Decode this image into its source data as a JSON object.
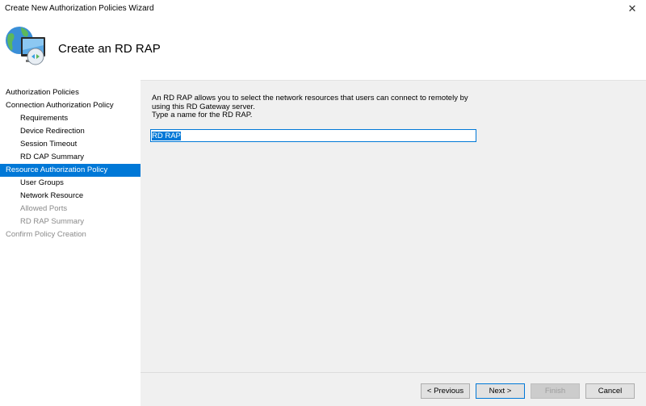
{
  "window": {
    "title": "Create New Authorization Policies Wizard",
    "close_glyph": "✕"
  },
  "header": {
    "icon": "globe-computer-gateway-icon",
    "title": "Create an RD RAP"
  },
  "nav": {
    "items": [
      {
        "label": "Authorization Policies",
        "level": 1,
        "state": "enabled"
      },
      {
        "label": "Connection Authorization Policy",
        "level": 1,
        "state": "enabled"
      },
      {
        "label": "Requirements",
        "level": 2,
        "state": "enabled"
      },
      {
        "label": "Device Redirection",
        "level": 2,
        "state": "enabled"
      },
      {
        "label": "Session Timeout",
        "level": 2,
        "state": "enabled"
      },
      {
        "label": "RD CAP Summary",
        "level": 2,
        "state": "enabled"
      },
      {
        "label": "Resource Authorization Policy",
        "level": 1,
        "state": "active"
      },
      {
        "label": "User Groups",
        "level": 2,
        "state": "enabled"
      },
      {
        "label": "Network Resource",
        "level": 2,
        "state": "enabled"
      },
      {
        "label": "Allowed Ports",
        "level": 2,
        "state": "disabled"
      },
      {
        "label": "RD RAP Summary",
        "level": 2,
        "state": "disabled"
      },
      {
        "label": "Confirm Policy Creation",
        "level": 1,
        "state": "disabled"
      }
    ]
  },
  "content": {
    "description_line1": "An RD RAP allows you to select the network resources that users can connect to remotely by",
    "description_line2": "using this RD Gateway server.",
    "prompt": "Type a name for the RD RAP.",
    "name_value": "RD RAP"
  },
  "footer": {
    "previous_label": "< Previous",
    "next_label": "Next >",
    "finish_label": "Finish",
    "cancel_label": "Cancel"
  },
  "colors": {
    "accent": "#0078d7",
    "content_bg": "#f0f0f0",
    "disabled_text": "#8a8a8a"
  }
}
